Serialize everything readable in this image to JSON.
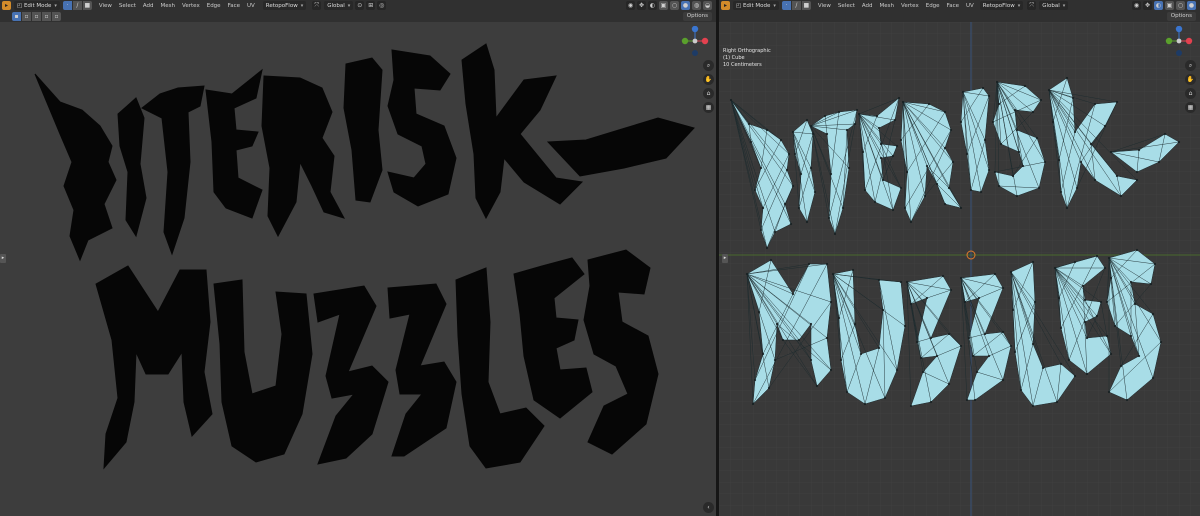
{
  "left": {
    "header": {
      "mode_label": "Edit Mode",
      "menus": [
        "View",
        "Select",
        "Add",
        "Mesh",
        "Vertex",
        "Edge",
        "Face",
        "UV"
      ],
      "snap_label": "RetopoFlow",
      "orientation_label": "Global",
      "options_label": "Options"
    }
  },
  "right": {
    "header": {
      "mode_label": "Edit Mode",
      "menus": [
        "View",
        "Select",
        "Add",
        "Mesh",
        "Vertex",
        "Edge",
        "Face",
        "UV"
      ],
      "snap_label": "RetopoFlow",
      "orientation_label": "Global",
      "options_label": "Options"
    },
    "overlay_info": {
      "view_name": "Right Orthographic",
      "object_name": "(1) Cube",
      "scale": "10 Centimeters"
    },
    "mesh_color": "#a8dde7"
  },
  "gizmo": {
    "x_label": "X",
    "y_label": "Y",
    "z_label": "Z",
    "x_color": "#e3414f",
    "y_color": "#5aa02c",
    "z_color": "#3a75cf"
  },
  "icons": {
    "editor_type": "blender-viewport-icon",
    "zoom": "magnifier-icon",
    "pan": "hand-icon",
    "camera": "camera-icon",
    "grid": "grid-icon"
  }
}
